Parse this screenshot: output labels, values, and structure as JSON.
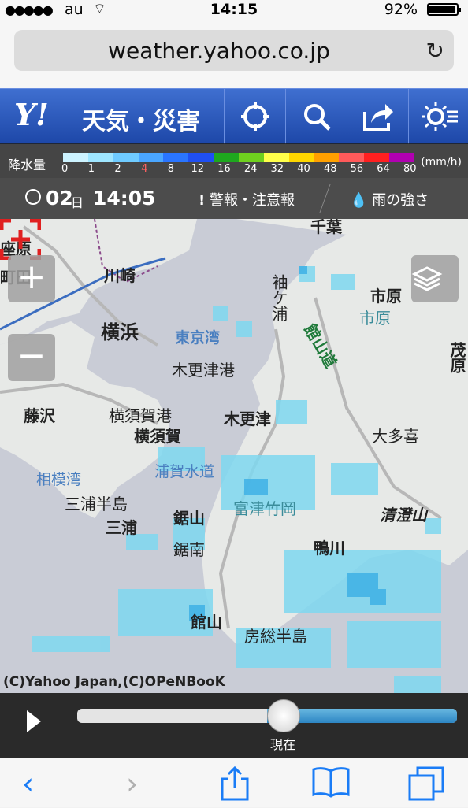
{
  "status": {
    "carrier": "au",
    "time": "14:15",
    "battery": "92%"
  },
  "browser": {
    "url": "weather.yahoo.co.jp"
  },
  "header": {
    "logo": "Y!",
    "title": "天気・災害"
  },
  "legend": {
    "label": "降水量",
    "ticks": [
      "0",
      "1",
      "2",
      "4",
      "8",
      "12",
      "16",
      "24",
      "32",
      "40",
      "48",
      "56",
      "64",
      "80"
    ],
    "unit": "(mm/h)",
    "colors": [
      "#cdf3ff",
      "#9fe6ff",
      "#6fcbff",
      "#4aa6ff",
      "#2a75ff",
      "#1f4ff2",
      "#1ea81e",
      "#6fd01e",
      "#ffff4a",
      "#ffd700",
      "#ffa000",
      "#ff5a5a",
      "#ff2020",
      "#b000b0"
    ]
  },
  "timebar": {
    "date": "02",
    "day": "日",
    "time": "14:05",
    "warning": "警報・注意報",
    "rain": "雨の強さ"
  },
  "map": {
    "labels": {
      "kawasaki": "川崎",
      "yokohama": "横浜",
      "tokyo_bay": "東京湾",
      "kisarazu_port": "木更津港",
      "kisarazu": "木更津",
      "fujisawa": "藤沢",
      "yokosuka_port": "横須賀港",
      "yokosuka": "横須賀",
      "sagami_bay": "相模湾",
      "miura_peninsula": "三浦半島",
      "miura": "三浦",
      "uraga": "浦賀水道",
      "futtsu": "富津竹岡",
      "nokogiri": "鋸山",
      "kyonan": "鋸南",
      "tateyama": "館山",
      "boso": "房総半島",
      "kamogawa": "鴨川",
      "kiyosumi": "清澄山",
      "otaki": "大多喜",
      "ichihara": "市原",
      "ichihara2": "市原",
      "mobara": "茂原",
      "sodegaura": "袖ケ浦",
      "chiba": "千葉",
      "ebina": "座原",
      "atsugi": "町田",
      "tateyama_road": "館山道"
    },
    "copyright": "(C)Yahoo Japan,(C)OPeNBooK"
  },
  "player": {
    "now_label": "現在",
    "progress_percent": 50
  }
}
